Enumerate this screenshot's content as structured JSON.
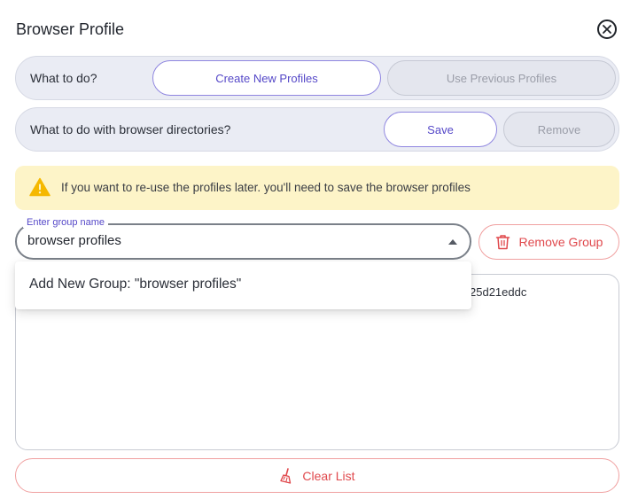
{
  "dialog": {
    "title": "Browser Profile",
    "close_icon": "close-circle-icon"
  },
  "what_to_do": {
    "label": "What to do?",
    "options": [
      "Create New Profiles",
      "Use Previous Profiles"
    ],
    "selected": "Create New Profiles"
  },
  "directories": {
    "label": "What to do with browser directories?",
    "options": [
      "Save",
      "Remove"
    ],
    "selected": "Save"
  },
  "warning": {
    "icon": "warning-triangle-icon",
    "text": "If you want to re-use the profiles later. you'll need to save the browser profiles"
  },
  "group": {
    "legend": "Enter group name",
    "value": "browser profiles",
    "dropdown_option": "Add New Group: \"browser profiles\"",
    "remove_label": "Remove Group",
    "remove_icon": "trash-icon"
  },
  "profiles_list": {
    "visible_text": "25d21eddc"
  },
  "clear": {
    "label": "Clear List",
    "icon": "broom-icon"
  },
  "colors": {
    "accent": "#5548c8",
    "danger": "#e0484c",
    "warning_bg": "#fdf4c8",
    "warning_icon": "#f5b800",
    "card_bg": "#eaecf4"
  }
}
